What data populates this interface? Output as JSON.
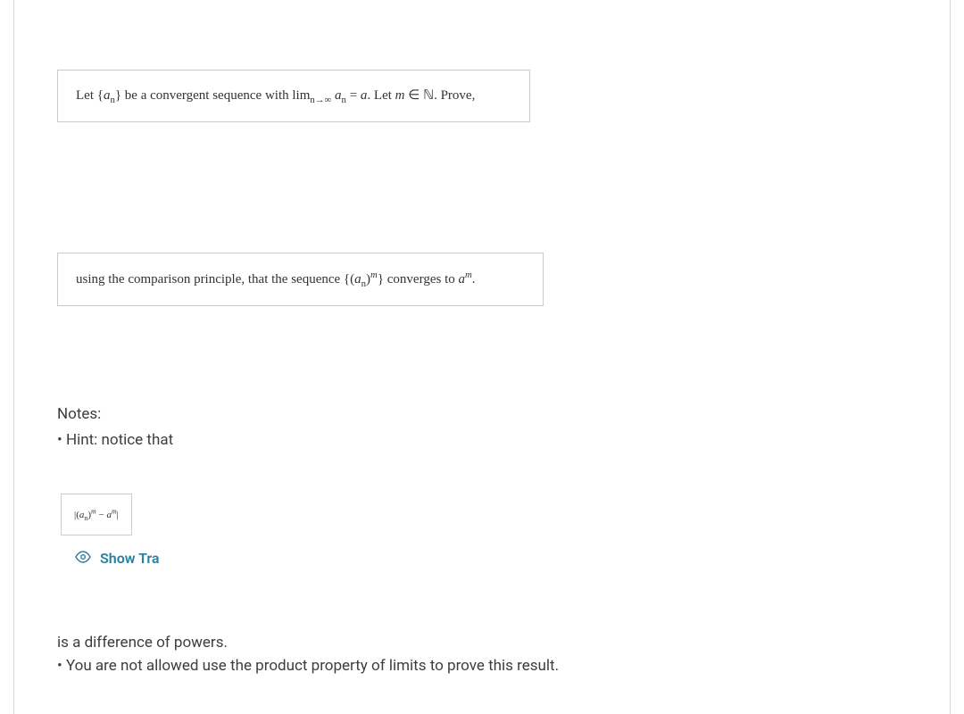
{
  "problem": {
    "line1_pre": "Let {",
    "line1_an": "a",
    "line1_sub_n": "n",
    "line1_mid1": "} be a convergent sequence with lim",
    "line1_sub_lim": "n→∞",
    "line1_mid2": " ",
    "line1_an2": "a",
    "line1_sub_n2": "n",
    "line1_eq": " = ",
    "line1_a": "a",
    "line1_post": ".  Let ",
    "line1_m": "m",
    "line1_in": " ∈ ℕ.  Prove,",
    "line2_pre": "using the comparison principle, that the sequence {(",
    "line2_an": "a",
    "line2_sub_n": "n",
    "line2_mid": ")",
    "line2_m": "m",
    "line2_post": "} converges to ",
    "line2_a": "a",
    "line2_am": "m",
    "line2_end": "."
  },
  "formula": {
    "open": "|(",
    "a": "a",
    "sub_n": "n",
    "close1": ")",
    "m1": "m",
    "minus": " − ",
    "a2": "a",
    "m2": "m",
    "close2": "|"
  },
  "notes": {
    "heading": "Notes:",
    "hint_bullet": "• Hint: notice that"
  },
  "show_trans": {
    "label": "Show Tra"
  },
  "bottom": {
    "line1": "is a difference of powers.",
    "line2": "• You are not allowed use the product property of limits to prove this result."
  }
}
